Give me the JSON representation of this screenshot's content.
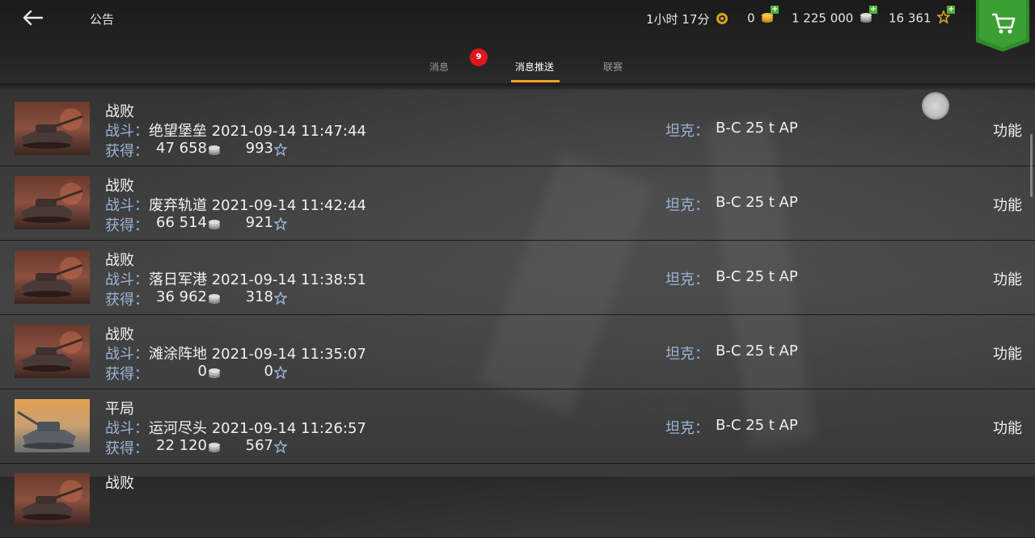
{
  "header": {
    "title": "公告",
    "timer": "1小时 17分",
    "gold": "0",
    "silver": "1 225 000",
    "free_xp": "16 361"
  },
  "tabs": [
    {
      "label": "消息",
      "badge": "9"
    },
    {
      "label": "消息推送"
    },
    {
      "label": "联赛"
    }
  ],
  "rows": [
    {
      "result": "战败",
      "battle_label": "战斗：",
      "battle": "绝望堡垒 2021-09-14 11:47:44",
      "earn_label": "获得：",
      "silver": "47 658",
      "xp": "993",
      "tank_label": "坦克：",
      "tank": "B-C 25 t AP",
      "func": "功能",
      "thumb": "defeat"
    },
    {
      "result": "战败",
      "battle_label": "战斗：",
      "battle": "废弃轨道 2021-09-14 11:42:44",
      "earn_label": "获得：",
      "silver": "66 514",
      "xp": "921",
      "tank_label": "坦克：",
      "tank": "B-C 25 t AP",
      "func": "功能",
      "thumb": "defeat"
    },
    {
      "result": "战败",
      "battle_label": "战斗：",
      "battle": "落日军港 2021-09-14 11:38:51",
      "earn_label": "获得：",
      "silver": "36 962",
      "xp": "318",
      "tank_label": "坦克：",
      "tank": "B-C 25 t AP",
      "func": "功能",
      "thumb": "defeat"
    },
    {
      "result": "战败",
      "battle_label": "战斗：",
      "battle": "滩涂阵地 2021-09-14 11:35:07",
      "earn_label": "获得：",
      "silver": "0",
      "xp": "0",
      "tank_label": "坦克：",
      "tank": "B-C 25 t AP",
      "func": "功能",
      "thumb": "defeat"
    },
    {
      "result": "平局",
      "battle_label": "战斗：",
      "battle": "运河尽头 2021-09-14 11:26:57",
      "earn_label": "获得：",
      "silver": "22 120",
      "xp": "567",
      "tank_label": "坦克：",
      "tank": "B-C 25 t AP",
      "func": "功能",
      "thumb": "draw"
    },
    {
      "result": "战败",
      "thumb": "defeat"
    }
  ]
}
